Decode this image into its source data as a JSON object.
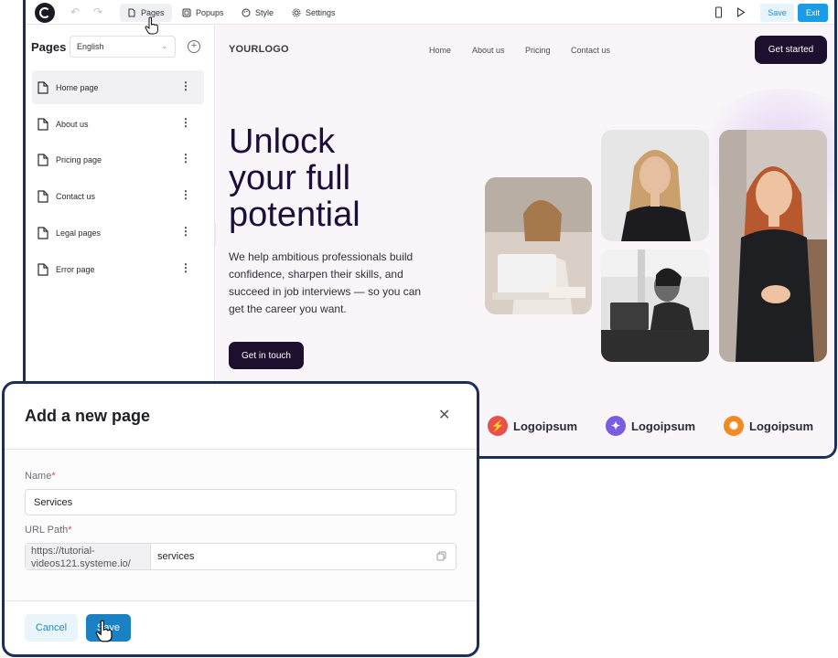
{
  "topbar": {
    "tabs": [
      {
        "label": "Pages",
        "icon": "page-icon",
        "active": true
      },
      {
        "label": "Popups",
        "icon": "popup-icon",
        "active": false
      },
      {
        "label": "Style",
        "icon": "palette-icon",
        "active": false
      },
      {
        "label": "Settings",
        "icon": "gear-icon",
        "active": false
      }
    ],
    "save_label": "Save",
    "exit_label": "Exit"
  },
  "sidebar": {
    "title": "Pages",
    "language": "English",
    "items": [
      {
        "label": "Home page",
        "active": true
      },
      {
        "label": "About us",
        "active": false
      },
      {
        "label": "Pricing page",
        "active": false
      },
      {
        "label": "Contact us",
        "active": false
      },
      {
        "label": "Legal pages",
        "active": false
      },
      {
        "label": "Error page",
        "active": false
      }
    ]
  },
  "site": {
    "logo": "YOURLOGO",
    "nav": [
      "Home",
      "About us",
      "Pricing",
      "Contact us"
    ],
    "cta": "Get started",
    "hero_lines": [
      "Unlock",
      "your full",
      "potential"
    ],
    "description": "We help ambitious professionals build confidence, sharpen their skills, and succeed in job interviews — so you can get the career you want.",
    "contact_button": "Get in touch",
    "partners": [
      {
        "name": "Logoipsum",
        "color": "#e8504a"
      },
      {
        "name": "Logoipsum",
        "color": "#7a5ce0"
      },
      {
        "name": "Logoipsum",
        "color": "#f08a24"
      }
    ]
  },
  "modal": {
    "title": "Add a new page",
    "name_label": "Name",
    "name_value": "Services",
    "url_label": "URL Path",
    "url_prefix": "https://tutorial-videos121.systeme.io/",
    "url_value": "services",
    "cancel_label": "Cancel",
    "save_label": "Save"
  },
  "colors": {
    "frame": "#1c2f5b",
    "accent": "#1a9be8",
    "dark_button": "#1d0f2e"
  }
}
